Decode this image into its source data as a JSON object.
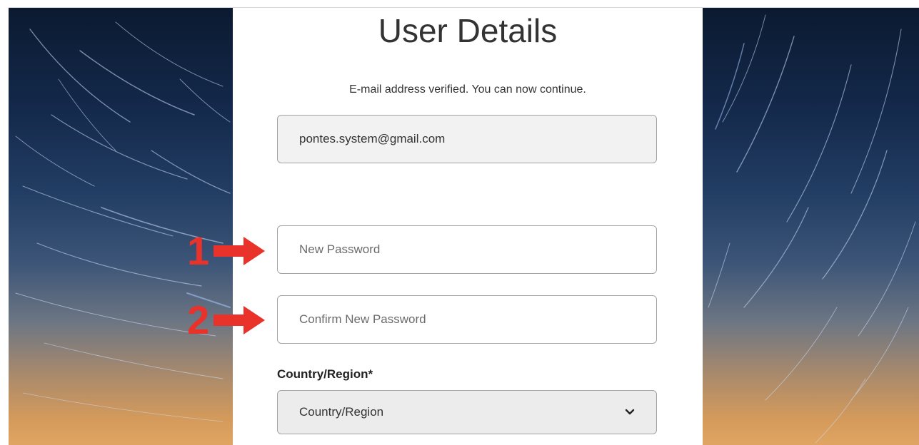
{
  "page": {
    "title": "User Details",
    "verified_message": "E-mail address verified. You can now continue."
  },
  "form": {
    "email_value": "pontes.system@gmail.com",
    "new_password_placeholder": "New Password",
    "confirm_password_placeholder": "Confirm New Password",
    "country_label": "Country/Region*",
    "country_selected": "Country/Region"
  },
  "annotations": {
    "marker_1": "1",
    "marker_2": "2",
    "color": "#e8322a"
  },
  "icons": {
    "select_chevron": "chevron-down-icon",
    "annotation_arrow": "arrow-right-icon"
  }
}
